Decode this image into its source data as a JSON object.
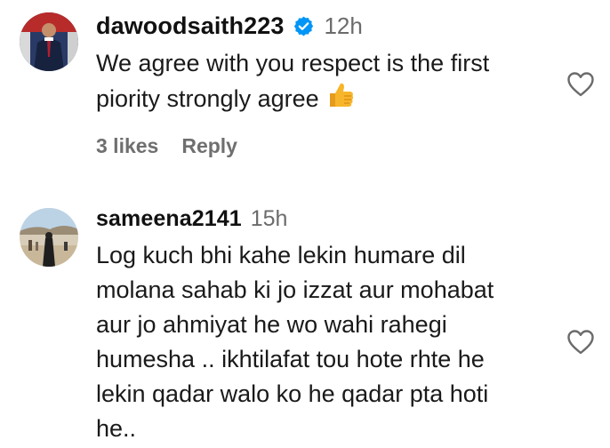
{
  "comments": [
    {
      "username": "dawoodsaith223",
      "verified": true,
      "time": "12h",
      "lines": [
        "We agree with you respect is the first",
        "piority strongly agree"
      ],
      "emoji": "thumbs-up",
      "likes": "3 likes",
      "reply": "Reply",
      "like_icon": "heart-outline-icon"
    },
    {
      "username": "sameena2141",
      "verified": false,
      "time": "15h",
      "lines": [
        "Log kuch bhi kahe lekin humare dil",
        "molana sahab ki jo izzat aur mohabat",
        "aur jo ahmiyat he wo wahi rahegi",
        "humesha .. ikhtilafat tou hote rhte he",
        "lekin qadar walo ko he qadar pta hoti",
        "he.."
      ],
      "like_icon": "heart-outline-icon"
    }
  ],
  "colors": {
    "text": "#1a1a1a",
    "secondary": "#6b6b6b",
    "verified_blue": "#0095f6",
    "thumb_yellow": "#f7b52b"
  }
}
